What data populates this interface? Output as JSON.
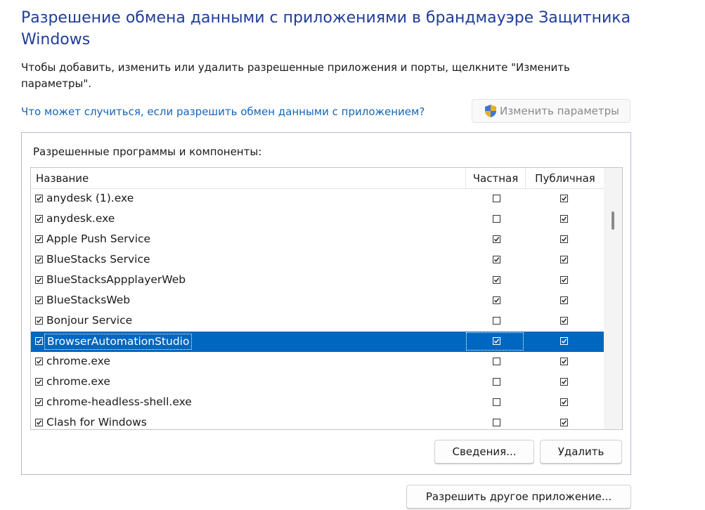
{
  "title": "Разрешение обмена данными с приложениями в брандмауэре Защитника Windows",
  "description": "Чтобы добавить, изменить или удалить разрешенные приложения и порты, щелкните \"Изменить параметры\".",
  "help_link": "Что может случиться, если разрешить обмен данными с приложением?",
  "change_settings_button": "Изменить параметры",
  "group_label": "Разрешенные программы и компоненты:",
  "columns": {
    "name": "Название",
    "private": "Частная",
    "public": "Публичная"
  },
  "apps": [
    {
      "name": "anydesk (1).exe",
      "enabled": true,
      "private": false,
      "public": true
    },
    {
      "name": "anydesk.exe",
      "enabled": true,
      "private": false,
      "public": true
    },
    {
      "name": "Apple Push Service",
      "enabled": true,
      "private": true,
      "public": true
    },
    {
      "name": "BlueStacks Service",
      "enabled": true,
      "private": true,
      "public": true
    },
    {
      "name": "BlueStacksAppplayerWeb",
      "enabled": true,
      "private": true,
      "public": true
    },
    {
      "name": "BlueStacksWeb",
      "enabled": true,
      "private": true,
      "public": true
    },
    {
      "name": "Bonjour Service",
      "enabled": true,
      "private": false,
      "public": true
    },
    {
      "name": "BrowserAutomationStudio",
      "enabled": true,
      "private": true,
      "public": true,
      "selected": true
    },
    {
      "name": "chrome.exe",
      "enabled": true,
      "private": false,
      "public": true
    },
    {
      "name": "chrome.exe",
      "enabled": true,
      "private": false,
      "public": true
    },
    {
      "name": "chrome-headless-shell.exe",
      "enabled": true,
      "private": false,
      "public": true
    },
    {
      "name": "Clash for Windows",
      "enabled": true,
      "private": false,
      "public": true
    }
  ],
  "buttons": {
    "details": "Сведения...",
    "delete": "Удалить",
    "allow_another": "Разрешить другое приложение..."
  },
  "colors": {
    "title": "#1f3d9a",
    "link": "#1565b8",
    "selection": "#0067c0",
    "group_border": "#b7b9d6"
  }
}
